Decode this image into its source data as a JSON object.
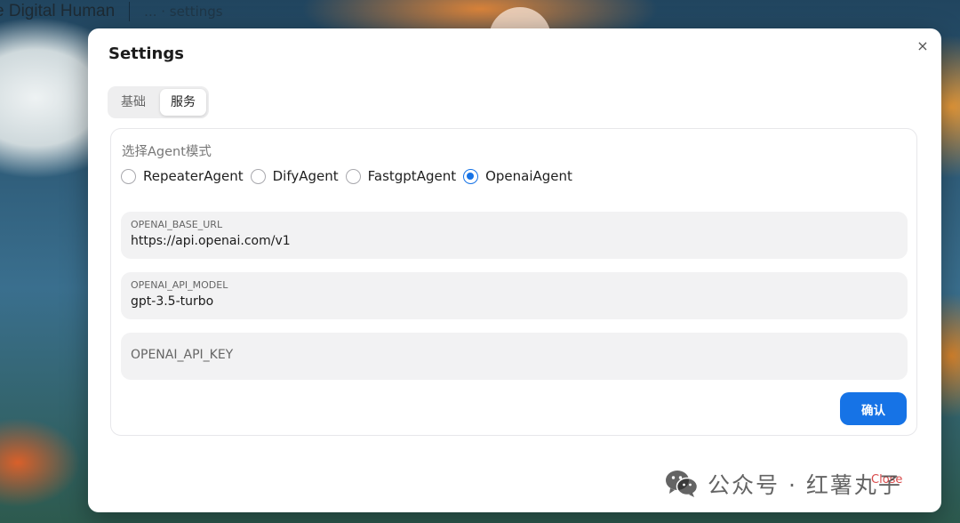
{
  "background": {
    "header_title": "e Digital Human",
    "header_crumbs": "... · settings"
  },
  "modal": {
    "title": "Settings",
    "close_icon": "×",
    "tabs": [
      {
        "label": "基础",
        "active": false
      },
      {
        "label": "服务",
        "active": true
      }
    ],
    "agent_mode": {
      "label": "选择Agent模式",
      "options": [
        {
          "label": "RepeaterAgent",
          "checked": false
        },
        {
          "label": "DifyAgent",
          "checked": false
        },
        {
          "label": "FastgptAgent",
          "checked": false
        },
        {
          "label": "OpenaiAgent",
          "checked": true
        }
      ]
    },
    "fields": [
      {
        "label": "OPENAI_BASE_URL",
        "value": "https://api.openai.com/v1"
      },
      {
        "label": "OPENAI_API_MODEL",
        "value": "gpt-3.5-turbo"
      },
      {
        "label": "",
        "value": "",
        "placeholder": "OPENAI_API_KEY"
      }
    ],
    "confirm_label": "确认",
    "footer_close_label": "Close"
  },
  "watermark": {
    "text": "公众号 · 红薯丸子",
    "icon": "wechat-icon"
  },
  "colors": {
    "accent": "#1673e6",
    "close_text": "#d94a4a"
  }
}
